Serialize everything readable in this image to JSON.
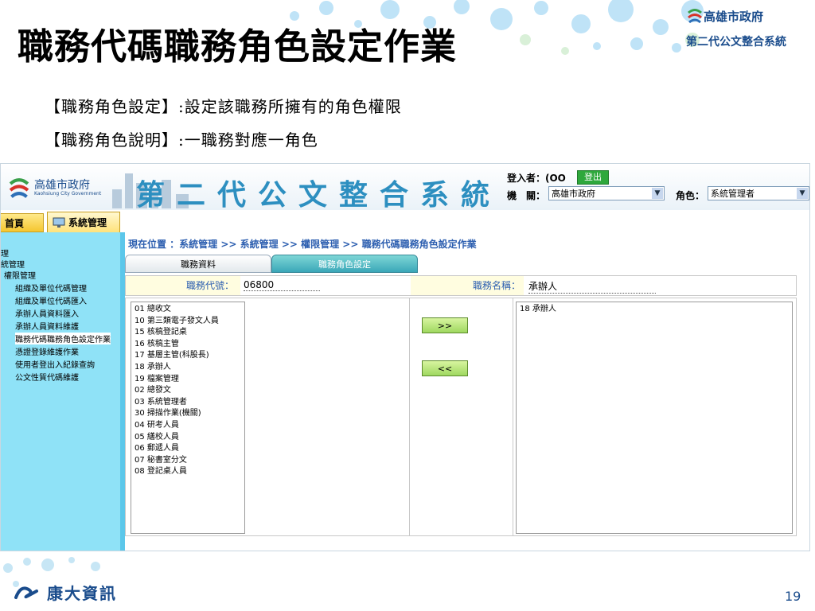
{
  "slide": {
    "title": "職務代碼職務角色設定作業",
    "logo_top_line1": "高雄市政府",
    "logo_top_line2": "第二代公文整合系統",
    "desc1": "【職務角色設定】:設定該職務所擁有的角色權限",
    "desc2": "【職務角色說明】:一職務對應一角色",
    "footer_logo": "康大資訊",
    "page_number": "19"
  },
  "app": {
    "logo_name": "高雄市政府",
    "logo_en": "Kaohsiung City Government",
    "title": "第二代公文整合系統",
    "login_label": "登入者：(OO",
    "logout_label": "登出",
    "org_label": "機　關：",
    "org_value": "高雄市政府",
    "role_label": "角色：",
    "role_value": "系統管理者",
    "tabs": {
      "home": "首頁",
      "system": "系統管理"
    },
    "sidebar": [
      "理",
      "統管理",
      "權限管理",
      "組織及單位代碼管理",
      "組織及單位代碼匯入",
      "承辦人員資料匯入",
      "承辦人員資料維護",
      "職務代碼職務角色設定作業",
      "憑證登錄維護作業",
      "使用者登出入紀錄查詢",
      "公文性質代碼維護"
    ],
    "breadcrumb": "現在位置 ：系統管理 >> 系統管理 >> 權限管理 >> 職務代碼職務角色設定作業",
    "subtabs": {
      "a": "職務資料",
      "b": "職務角色設定"
    },
    "code_label": "職務代號：",
    "code_value": "06800",
    "name_label": "職務名稱：",
    "name_value": "承辦人",
    "btn_add": ">>",
    "btn_remove": "<<",
    "available_roles": [
      "01 總收文",
      "10 第三類電子發文人員",
      "15 核稿登記桌",
      "16 核稿主管",
      "17 基層主管(科股長)",
      "18 承辦人",
      "19 檔案管理",
      "02 總發文",
      "03 系統管理者",
      "30 掃描作業(機關)",
      "04 研考人員",
      "05 繕校人員",
      "06 郵遞人員",
      "07 秘書室分文",
      "08 登記桌人員"
    ],
    "assigned_roles": [
      "18 承辦人"
    ]
  }
}
